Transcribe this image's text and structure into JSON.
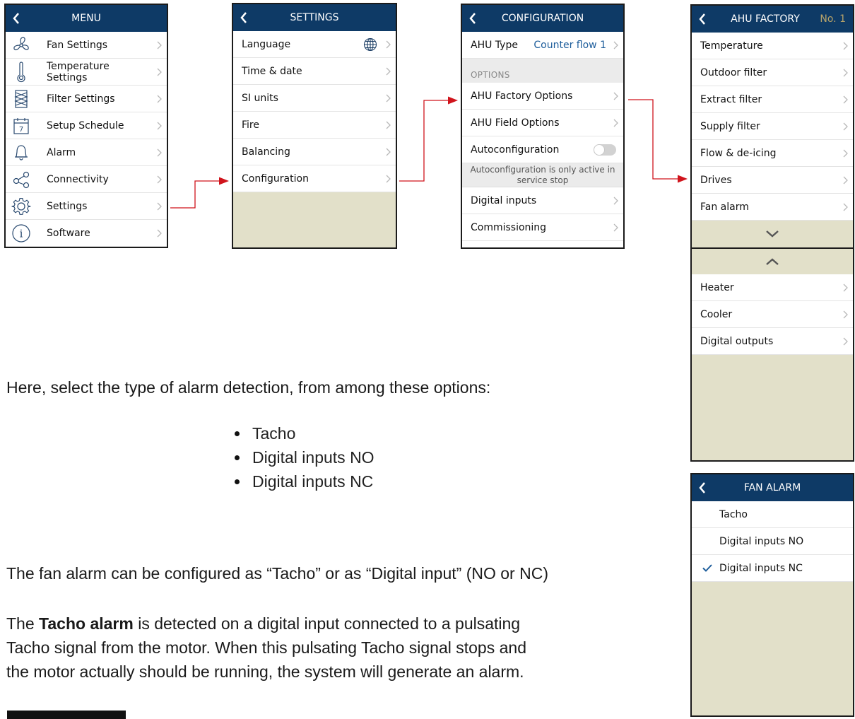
{
  "menu": {
    "title": "MENU",
    "items": [
      {
        "label": "Fan Settings",
        "icon": "fan-icon"
      },
      {
        "label": "Temperature Settings",
        "icon": "thermometer-icon"
      },
      {
        "label": "Filter Settings",
        "icon": "filter-icon"
      },
      {
        "label": "Setup Schedule",
        "icon": "calendar-icon",
        "icon_text": "7"
      },
      {
        "label": "Alarm",
        "icon": "bell-icon"
      },
      {
        "label": "Connectivity",
        "icon": "share-icon"
      },
      {
        "label": "Settings",
        "icon": "gear-icon"
      },
      {
        "label": "Software",
        "icon": "info-icon",
        "icon_text": "i"
      }
    ]
  },
  "settings": {
    "title": "SETTINGS",
    "items": [
      {
        "label": "Language",
        "icon": "globe-icon"
      },
      {
        "label": "Time & date"
      },
      {
        "label": "SI units"
      },
      {
        "label": "Fire"
      },
      {
        "label": "Balancing"
      },
      {
        "label": "Configuration"
      }
    ]
  },
  "configuration": {
    "title": "CONFIGURATION",
    "ahu_type_label": "AHU Type",
    "ahu_type_value": "Counter flow 1",
    "options_label": "OPTIONS",
    "factory_options": "AHU Factory Options",
    "field_options": "AHU Field Options",
    "autoconfig_label": "Autoconfiguration",
    "autoconfig_on": false,
    "autoconfig_note_1": "Autoconfiguration is only active in",
    "autoconfig_note_2": "service stop",
    "digital_inputs": "Digital inputs",
    "commissioning": "Commissioning"
  },
  "ahu_factory": {
    "title": "AHU FACTORY",
    "number": "No. 1",
    "items_page1": [
      "Temperature",
      "Outdoor filter",
      "Extract filter",
      "Supply filter",
      "Flow & de-icing",
      "Drives",
      "Fan alarm"
    ],
    "items_page2": [
      "Heater",
      "Cooler",
      "Digital outputs"
    ]
  },
  "fan_alarm": {
    "title": "FAN ALARM",
    "options": [
      {
        "label": "Tacho",
        "selected": false
      },
      {
        "label": "Digital inputs NO",
        "selected": false
      },
      {
        "label": "Digital inputs NC",
        "selected": true
      }
    ]
  },
  "body_text": {
    "intro": "Here, select the type of alarm detection,  from among these options:",
    "bullets": [
      "Tacho",
      "Digital inputs NO",
      "Digital inputs NC"
    ],
    "config_sentence": "The fan alarm can be configured as “Tacho” or as “Digital input” (NO or NC)",
    "tacho_prefix": "The ",
    "tacho_bold": "Tacho alarm",
    "tacho_line1_rest": " is detected on a digital input connected to a pulsating",
    "tacho_line2": "Tacho signal from the motor. When this pulsating Tacho signal stops and",
    "tacho_line3": "the motor actually should be running, the system will generate an alarm."
  },
  "colors": {
    "header": "#0e3a66",
    "panel_bg": "#e2e0c9",
    "arrow": "#d0141c",
    "value_blue": "#1d5d9b",
    "number_gold": "#b5a26a"
  }
}
